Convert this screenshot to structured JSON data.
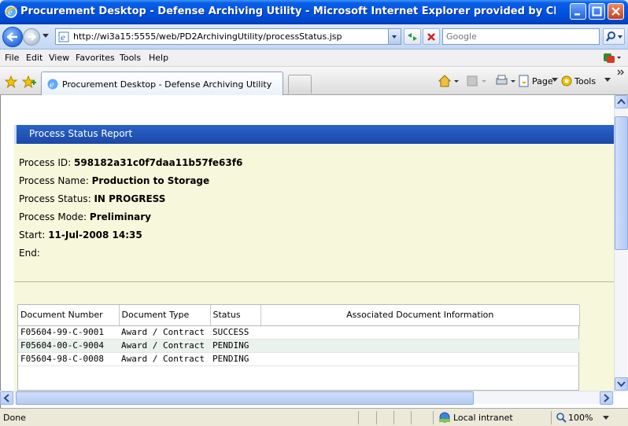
{
  "window": {
    "title": "Procurement Desktop - Defense Archiving Utility - Microsoft Internet Explorer provided by CIS of CACI, Inc. - Fed..."
  },
  "address": {
    "url": "http://wi3a15:5555/web/PD2ArchivingUtility/processStatus.jsp",
    "search_placeholder": "Google"
  },
  "menu": {
    "items": [
      "File",
      "Edit",
      "View",
      "Favorites",
      "Tools",
      "Help"
    ]
  },
  "tabs": {
    "active_label": "Procurement Desktop - Defense Archiving Utility"
  },
  "command_bar": {
    "page_label": "Page",
    "tools_label": "Tools"
  },
  "page": {
    "header": "Process Status Report",
    "fields": {
      "process_id_label": "Process ID:",
      "process_id_value": "598182a31c0f7daa11b57fe63f6",
      "process_name_label": "Process Name:",
      "process_name_value": "Production to Storage",
      "process_status_label": "Process Status:",
      "process_status_value": "IN PROGRESS",
      "process_mode_label": "Process Mode:",
      "process_mode_value": "Preliminary",
      "start_label": "Start:",
      "start_value": "11-Jul-2008 14:35",
      "end_label": "End:"
    },
    "table": {
      "columns": [
        "Document Number",
        "Document Type",
        "Status",
        "Associated Document Information"
      ],
      "rows": [
        [
          "F05604-99-C-9001",
          "Award / Contract",
          "SUCCESS",
          ""
        ],
        [
          "F05604-00-C-9004",
          "Award / Contract",
          "PENDING",
          ""
        ],
        [
          "F05604-98-C-0008",
          "Award / Contract",
          "PENDING",
          ""
        ]
      ]
    }
  },
  "status_bar": {
    "left_text": "Done",
    "zone": "Local intranet",
    "zoom": "100%"
  },
  "colors": {
    "header_blue": "#1c48a8",
    "page_background": "#f7f7dc",
    "alt_row": "#e9f2ec"
  }
}
